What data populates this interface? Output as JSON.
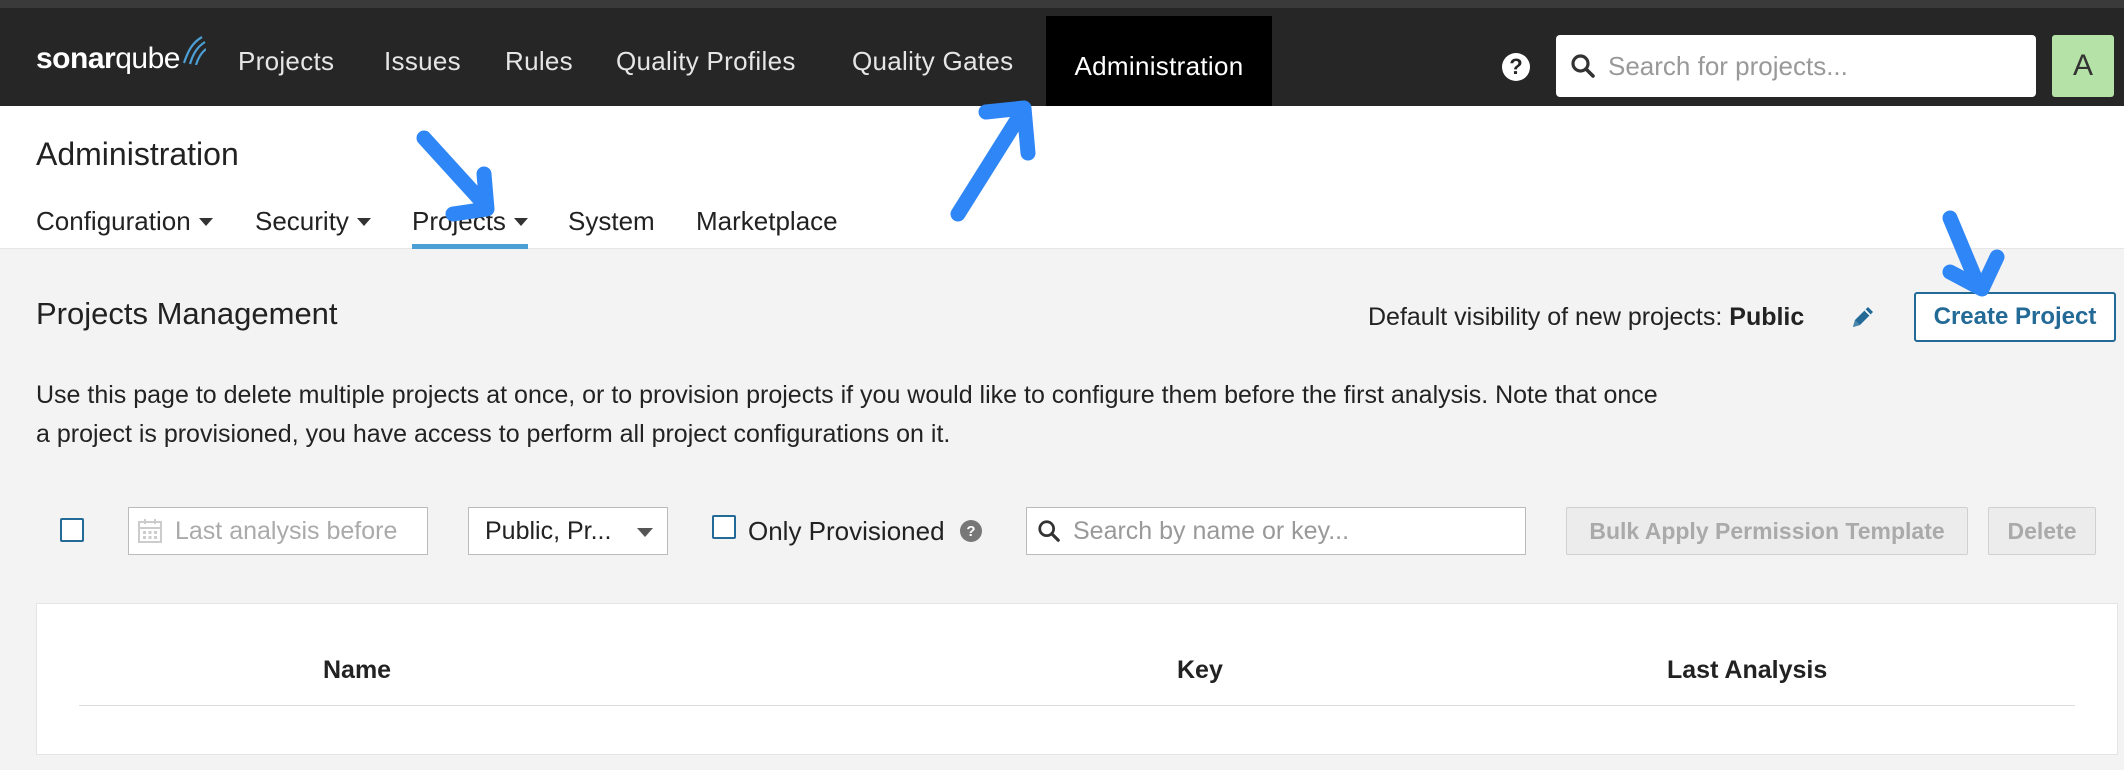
{
  "colors": {
    "topbar_bg": "#262626",
    "active_tab_bg": "#000000",
    "accent": "#4b9fd5",
    "primary": "#236a97",
    "avatar_bg": "#b5e3a7",
    "annotation_arrow": "#2f86f6"
  },
  "topnav": {
    "logo": {
      "brand_bold": "sonar",
      "brand_regular": "qube"
    },
    "items": [
      {
        "label": "Projects",
        "active": false
      },
      {
        "label": "Issues",
        "active": false
      },
      {
        "label": "Rules",
        "active": false
      },
      {
        "label": "Quality Profiles",
        "active": false
      },
      {
        "label": "Quality Gates",
        "active": false
      },
      {
        "label": "Administration",
        "active": true
      }
    ],
    "help_icon": "question-circle-icon",
    "help_glyph": "?",
    "search_placeholder": "Search for projects...",
    "avatar_letter": "A"
  },
  "admin": {
    "title": "Administration",
    "tabs": [
      {
        "label": "Configuration",
        "has_caret": true,
        "active": false
      },
      {
        "label": "Security",
        "has_caret": true,
        "active": false
      },
      {
        "label": "Projects",
        "has_caret": true,
        "active": true
      },
      {
        "label": "System",
        "has_caret": false,
        "active": false
      },
      {
        "label": "Marketplace",
        "has_caret": false,
        "active": false
      }
    ]
  },
  "main": {
    "title": "Projects Management",
    "visibility_prefix": "Default visibility of new projects: ",
    "visibility_value": "Public",
    "edit_icon": "pencil-icon",
    "create_button": "Create Project",
    "description": "Use this page to delete multiple projects at once, or to provision projects if you would like to configure them before the first analysis. Note that once a project is provisioned, you have access to perform all project configurations on it."
  },
  "filters": {
    "select_all_checked": false,
    "date_placeholder": "Last analysis before",
    "date_icon": "calendar-icon",
    "visibility_select_value": "Public, Pr...",
    "only_provisioned_label": "Only Provisioned",
    "only_provisioned_checked": false,
    "help_glyph": "?",
    "search_placeholder": "Search by name or key...",
    "bulk_apply_button": "Bulk Apply Permission Template",
    "delete_button": "Delete"
  },
  "table": {
    "columns": [
      "Name",
      "Key",
      "Last Analysis"
    ],
    "rows": []
  },
  "annotations": {
    "arrow_icon": "arrow-annotation-icon",
    "count": 3
  }
}
